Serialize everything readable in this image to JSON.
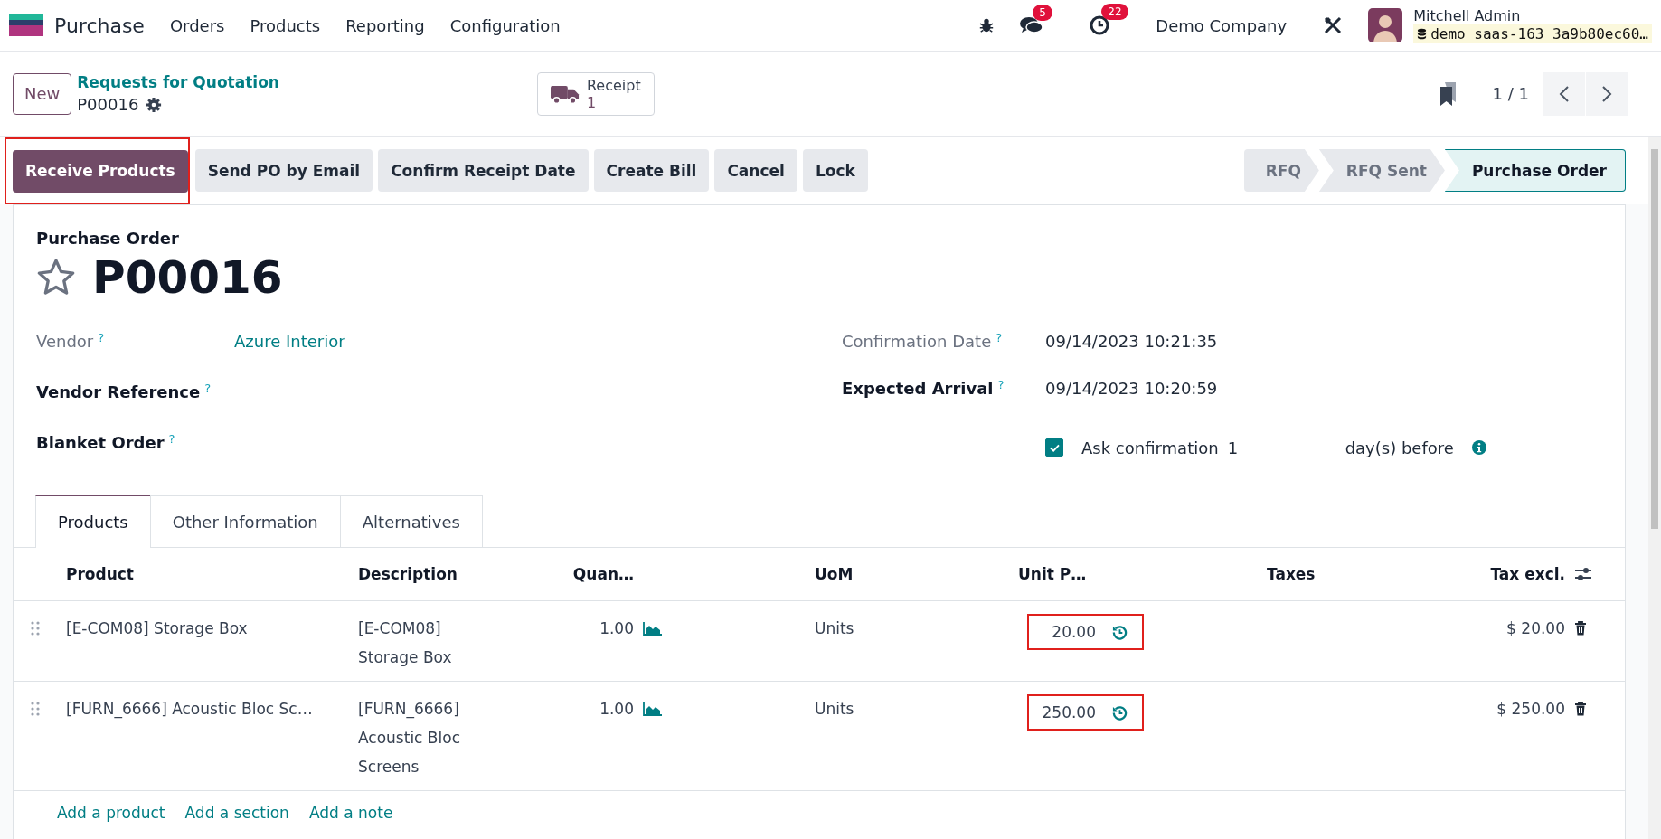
{
  "navbar": {
    "app_name": "Purchase",
    "menu": [
      "Orders",
      "Products",
      "Reporting",
      "Configuration"
    ],
    "messages_count": "5",
    "activities_count": "22",
    "company": "Demo Company",
    "user": {
      "name": "Mitchell Admin",
      "database": "demo_saas-163_3a9b80ec60…"
    }
  },
  "control_panel": {
    "new_button": "New",
    "breadcrumb": "Requests for Quotation",
    "record": "P00016",
    "smart_button": {
      "label": "Receipt",
      "count": "1"
    },
    "pager": "1 / 1"
  },
  "actions": [
    {
      "label": "Receive Products",
      "primary": true,
      "highlighted": true
    },
    {
      "label": "Send PO by Email",
      "primary": false,
      "highlighted": false
    },
    {
      "label": "Confirm Receipt Date",
      "primary": false,
      "highlighted": false
    },
    {
      "label": "Create Bill",
      "primary": false,
      "highlighted": false
    },
    {
      "label": "Cancel",
      "primary": false,
      "highlighted": false
    },
    {
      "label": "Lock",
      "primary": false,
      "highlighted": false
    }
  ],
  "status_steps": [
    {
      "label": "RFQ",
      "selected": false
    },
    {
      "label": "RFQ Sent",
      "selected": false
    },
    {
      "label": "Purchase Order",
      "selected": true
    }
  ],
  "form": {
    "record_type": "Purchase Order",
    "title": "P00016",
    "starred": false,
    "left_fields": [
      {
        "label": "Vendor",
        "help": "?",
        "readonly": true,
        "kind": "link",
        "value": "Azure Interior"
      },
      {
        "label": "Vendor Reference",
        "help": "?",
        "readonly": false
      },
      {
        "label": "Blanket Order",
        "help": "?",
        "readonly": false
      }
    ],
    "right_fields": [
      {
        "label": "Confirmation Date",
        "help": "?",
        "readonly": true,
        "kind": "text",
        "value": "09/14/2023 10:21:35"
      },
      {
        "label": "Expected Arrival",
        "help": "?",
        "readonly": false,
        "kind": "text",
        "value": "09/14/2023 10:20:59"
      }
    ],
    "ask_confirmation": {
      "checked": true,
      "label": "Ask confirmation",
      "days": "1",
      "suffix": "day(s) before"
    }
  },
  "tabs": [
    {
      "label": "Products",
      "selected": true
    },
    {
      "label": "Other Information",
      "selected": false
    },
    {
      "label": "Alternatives",
      "selected": false
    }
  ],
  "table": {
    "columns": [
      "Product",
      "Description",
      "Quan…",
      "UoM",
      "Unit P…",
      "Taxes",
      "Tax excl."
    ],
    "rows": [
      {
        "product": "[E-COM08] Storage Box",
        "description": "[E-COM08] Storage Box",
        "quantity": "1.00",
        "uom": "Units",
        "unit_price": "20.00",
        "price_highlighted": true,
        "subtotal": "$ 20.00"
      },
      {
        "product": "[FURN_6666] Acoustic Bloc Sc…",
        "description": "[FURN_6666] Acoustic Bloc Screens",
        "quantity": "1.00",
        "uom": "Units",
        "unit_price": "250.00",
        "price_highlighted": true,
        "subtotal": "$ 250.00"
      }
    ],
    "add_links": [
      "Add a product",
      "Add a section",
      "Add a note"
    ]
  }
}
